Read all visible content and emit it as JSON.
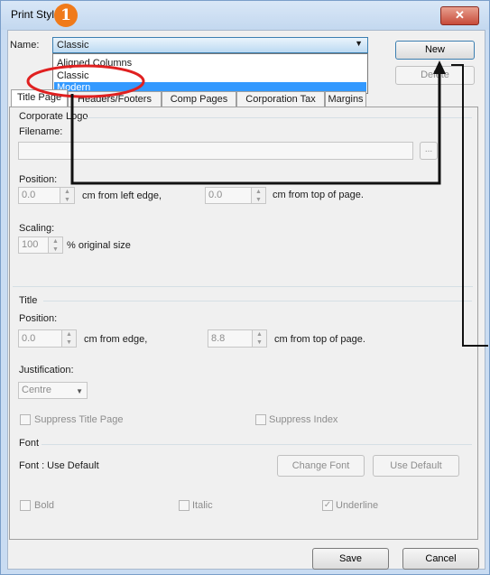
{
  "window": {
    "title": "Print Styles",
    "close_glyph": "✕"
  },
  "name_field": {
    "label": "Name:",
    "selected": "Classic"
  },
  "dropdown_list": {
    "items": [
      "Aligned Columns",
      "Classic",
      "Modern"
    ],
    "highlighted": "Modern"
  },
  "buttons": {
    "new": "New",
    "delete": "Delete",
    "save": "Save",
    "cancel": "Cancel",
    "change_font": "Change Font",
    "use_default": "Use Default",
    "ellipsis": "..."
  },
  "tabs": [
    "Title Page",
    "Headers/Footers",
    "Comp Pages",
    "Corporation Tax",
    "Margins"
  ],
  "corporate_logo": {
    "group_title": "Corporate Logo",
    "filename_label": "Filename:",
    "filename_value": "",
    "position_label": "Position:",
    "left_value": "0.0",
    "left_suffix": "cm from left edge,",
    "top_value": "0.0",
    "top_suffix": "cm from top of page.",
    "scaling_label": "Scaling:",
    "scaling_value": "100",
    "scaling_suffix": "% original size"
  },
  "title_section": {
    "group_title": "Title",
    "position_label": "Position:",
    "edge_value": "0.0",
    "edge_suffix": "cm from edge,",
    "top_value": "8.8",
    "top_suffix": "cm from top of page.",
    "justification_label": "Justification:",
    "justification_value": "Centre",
    "suppress_title": "Suppress Title Page",
    "suppress_index": "Suppress Index"
  },
  "font_section": {
    "group_title": "Font",
    "font_status": "Font : Use Default",
    "bold": "Bold",
    "italic": "Italic",
    "underline": "Underline",
    "underline_checked": true
  },
  "annotation": {
    "step_number": "1",
    "badge_color": "#f07a1a",
    "ellipse_color": "#e02020",
    "arrow_color": "#111111"
  }
}
